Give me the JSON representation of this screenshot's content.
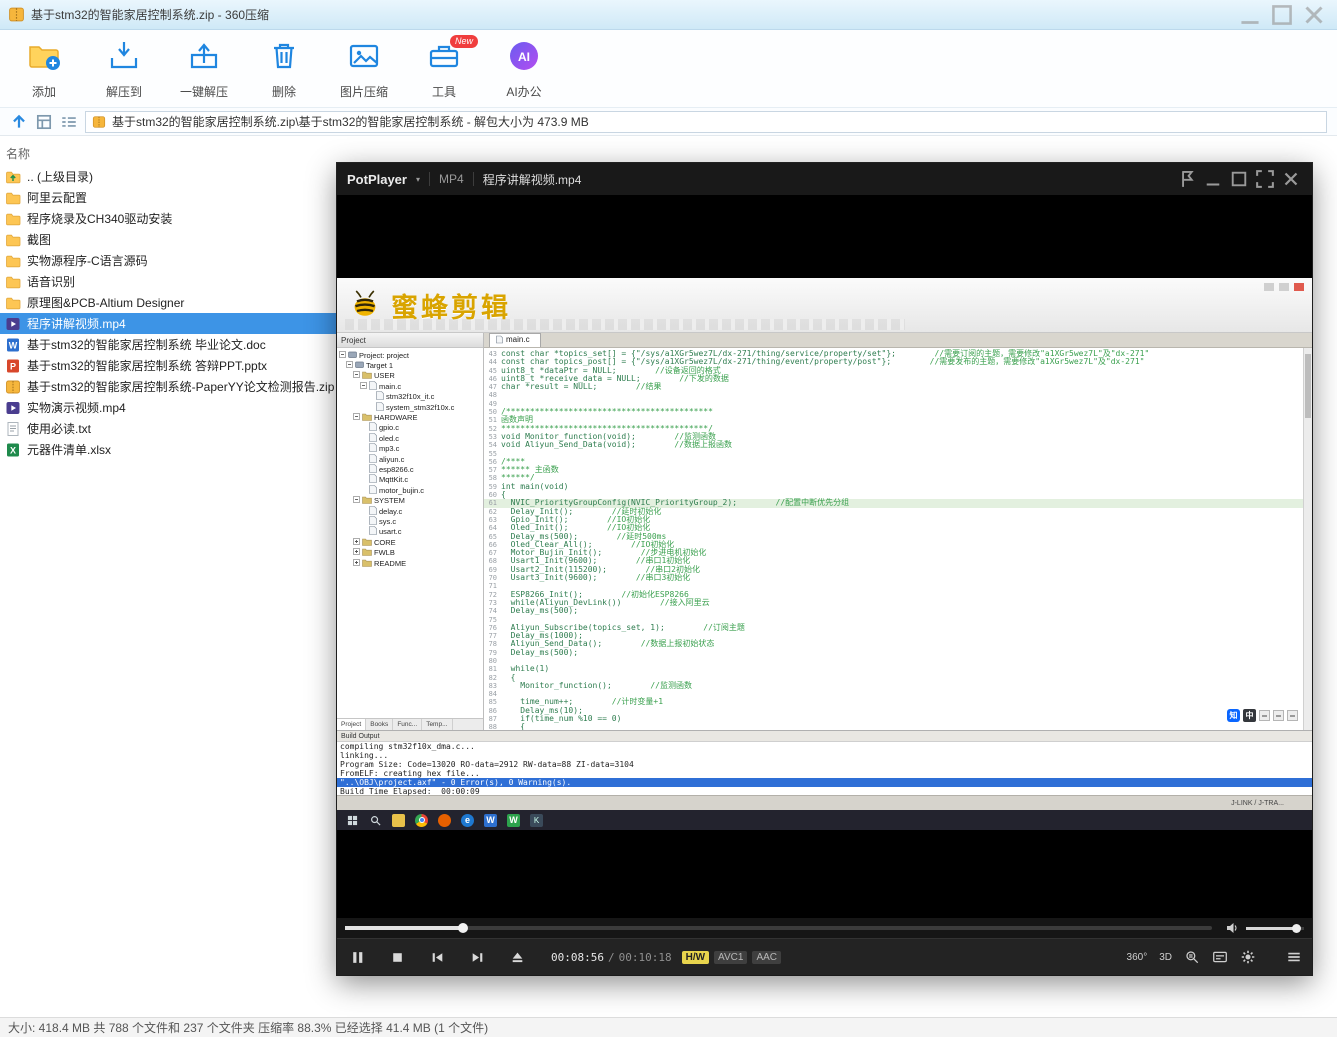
{
  "titlebar": {
    "title": "基于stm32的智能家居控制系统.zip - 360压缩"
  },
  "window_controls": [
    "minimize",
    "maximize",
    "close"
  ],
  "toolbar": {
    "items": [
      {
        "label": "添加",
        "icon": "add-files-icon"
      },
      {
        "label": "解压到",
        "icon": "extract-to-icon"
      },
      {
        "label": "一键解压",
        "icon": "one-click-extract-icon"
      },
      {
        "label": "删除",
        "icon": "delete-icon"
      },
      {
        "label": "图片压缩",
        "icon": "image-compress-icon"
      },
      {
        "label": "工具",
        "icon": "tools-icon",
        "badge": "New"
      },
      {
        "label": "AI办公",
        "icon": "ai-office-icon"
      }
    ]
  },
  "addressbar": {
    "buttons": [
      "up-icon",
      "view-grid-icon",
      "view-list-icon"
    ],
    "path": "基于stm32的智能家居控制系统.zip\\基于stm32的智能家居控制系统 - 解包大小为 473.9 MB"
  },
  "filelist": {
    "header": "名称",
    "items": [
      {
        "name": ".. (上级目录)",
        "type": "up"
      },
      {
        "name": "阿里云配置",
        "type": "folder"
      },
      {
        "name": "程序烧录及CH340驱动安装",
        "type": "folder"
      },
      {
        "name": "截图",
        "type": "folder"
      },
      {
        "name": "实物源程序-C语言源码",
        "type": "folder"
      },
      {
        "name": "语音识别",
        "type": "folder"
      },
      {
        "name": "原理图&PCB-Altium Designer",
        "type": "folder"
      },
      {
        "name": "程序讲解视频.mp4",
        "type": "mp4",
        "selected": true
      },
      {
        "name": "基于stm32的智能家居控制系统 毕业论文.doc",
        "type": "doc"
      },
      {
        "name": "基于stm32的智能家居控制系统 答辩PPT.pptx",
        "type": "ppt"
      },
      {
        "name": "基于stm32的智能家居控制系统-PaperYY论文检测报告.zip",
        "type": "zip"
      },
      {
        "name": "实物演示视频.mp4",
        "type": "mp4"
      },
      {
        "name": "使用必读.txt",
        "type": "txt"
      },
      {
        "name": "元器件清单.xlsx",
        "type": "xlsx"
      }
    ]
  },
  "statusbar": {
    "text": "大小: 418.4 MB 共 788 个文件和 237 个文件夹 压缩率 88.3% 已经选择 41.4 MB (1 个文件)"
  },
  "player": {
    "app": "PotPlayer",
    "format": "MP4",
    "file": "程序讲解视频.mp4",
    "title_buttons": [
      "pin",
      "minimize",
      "maximize",
      "fullscreen",
      "close"
    ],
    "controls": [
      "pause",
      "stop",
      "previous",
      "next",
      "open"
    ],
    "time_current": "00:08:56",
    "time_sep": "/",
    "time_total": "00:10:18",
    "decode_badge": "H/W",
    "codec_video": "AVC1",
    "codec_audio": "AAC",
    "right_labels": [
      "360°",
      "3D"
    ],
    "right_icons": [
      "subtitle-browse",
      "subtitle-panel",
      "settings"
    ],
    "menu_icon": "menu",
    "watermark": "蜜蜂剪辑"
  },
  "keil": {
    "project_header": "Project",
    "tree": [
      {
        "label": "Project: project",
        "level": 0,
        "icon": "target",
        "exp": true
      },
      {
        "label": "Target 1",
        "level": 1,
        "icon": "target",
        "exp": true
      },
      {
        "label": "USER",
        "level": 2,
        "icon": "folder",
        "exp": true
      },
      {
        "label": "main.c",
        "level": 3,
        "icon": "file",
        "exp": true
      },
      {
        "label": "stm32f10x_it.c",
        "level": 4,
        "icon": "file"
      },
      {
        "label": "system_stm32f10x.c",
        "level": 4,
        "icon": "file"
      },
      {
        "label": "HARDWARE",
        "level": 2,
        "icon": "folder",
        "exp": true
      },
      {
        "label": "gpio.c",
        "level": 3,
        "icon": "file"
      },
      {
        "label": "oled.c",
        "level": 3,
        "icon": "file"
      },
      {
        "label": "mp3.c",
        "level": 3,
        "icon": "file"
      },
      {
        "label": "aliyun.c",
        "level": 3,
        "icon": "file"
      },
      {
        "label": "esp8266.c",
        "level": 3,
        "icon": "file"
      },
      {
        "label": "MqttKit.c",
        "level": 3,
        "icon": "file"
      },
      {
        "label": "motor_bujin.c",
        "level": 3,
        "icon": "file"
      },
      {
        "label": "SYSTEM",
        "level": 2,
        "icon": "folder",
        "exp": true
      },
      {
        "label": "delay.c",
        "level": 3,
        "icon": "file"
      },
      {
        "label": "sys.c",
        "level": 3,
        "icon": "file"
      },
      {
        "label": "usart.c",
        "level": 3,
        "icon": "file"
      },
      {
        "label": "CORE",
        "level": 2,
        "icon": "folder",
        "exp": false
      },
      {
        "label": "FWLB",
        "level": 2,
        "icon": "folder",
        "exp": false
      },
      {
        "label": "README",
        "level": 2,
        "icon": "folder",
        "exp": false
      }
    ],
    "tabs": [
      {
        "label": "Project",
        "active": true
      },
      {
        "label": "Books",
        "active": false
      },
      {
        "label": "Func...",
        "active": false
      },
      {
        "label": "Temp...",
        "active": false
      }
    ],
    "editor_tab": "main.c",
    "code": [
      {
        "n": 43,
        "c": "const char *topics_set[] = {\"/sys/a1XGr5wez7L/dx-271/thing/service/property/set\"};",
        "m": "//需要订阅的主题，需要修改\"a1XGr5wez7L\"及\"dx-271\""
      },
      {
        "n": 44,
        "c": "const char topics_post[] = {\"/sys/a1XGr5wez7L/dx-271/thing/event/property/post\"};",
        "m": "//需要发布的主题，需要修改\"a1XGr5wez7L\"及\"dx-271\""
      },
      {
        "n": 45,
        "c": "uint8_t *dataPtr = NULL;",
        "m": "//设备返回的格式"
      },
      {
        "n": 46,
        "c": "uint8_t *receive_data = NULL;",
        "m": "//下发的数据"
      },
      {
        "n": 47,
        "c": "char *result = NULL;",
        "m": "//结果"
      },
      {
        "n": 48,
        "c": "",
        "m": ""
      },
      {
        "n": 49,
        "c": "",
        "m": ""
      },
      {
        "n": 50,
        "c": "",
        "m": "/*******************************************"
      },
      {
        "n": 51,
        "c": "",
        "m": "函数声明"
      },
      {
        "n": 52,
        "c": "",
        "m": "*******************************************/"
      },
      {
        "n": 53,
        "c": "void Monitor_function(void);",
        "m": "//监测函数"
      },
      {
        "n": 54,
        "c": "void Aliyun_Send_Data(void);",
        "m": "//数据上报函数"
      },
      {
        "n": 55,
        "c": "",
        "m": ""
      },
      {
        "n": 56,
        "c": "",
        "m": "/****"
      },
      {
        "n": 57,
        "c": "",
        "m": "****** 主函数"
      },
      {
        "n": 58,
        "c": "",
        "m": "******/"
      },
      {
        "n": 59,
        "c": "int main(void)",
        "m": ""
      },
      {
        "n": 60,
        "c": "{",
        "m": ""
      },
      {
        "n": 61,
        "c": "  NVIC_PriorityGroupConfig(NVIC_PriorityGroup_2);",
        "m": "//配置中断优先分组",
        "hl": true
      },
      {
        "n": 62,
        "c": "  Delay_Init();",
        "m": "//延时初始化"
      },
      {
        "n": 63,
        "c": "  Gpio_Init();",
        "m": "//IO初始化"
      },
      {
        "n": 64,
        "c": "  Oled_Init();",
        "m": "//IO初始化"
      },
      {
        "n": 65,
        "c": "  Delay_ms(500);",
        "m": "//延时500ms"
      },
      {
        "n": 66,
        "c": "  Oled_Clear_All();",
        "m": "//IO初始化"
      },
      {
        "n": 67,
        "c": "  Motor_Bujin_Init();",
        "m": "//步进电机初始化"
      },
      {
        "n": 68,
        "c": "  Usart1_Init(9600);",
        "m": "//串口1初始化"
      },
      {
        "n": 69,
        "c": "  Usart2_Init(115200);",
        "m": "//串口2初始化"
      },
      {
        "n": 70,
        "c": "  Usart3_Init(9600);",
        "m": "//串口3初始化"
      },
      {
        "n": 71,
        "c": "",
        "m": ""
      },
      {
        "n": 72,
        "c": "  ESP8266_Init();",
        "m": "//初始化ESP8266"
      },
      {
        "n": 73,
        "c": "  while(Aliyun_DevLink())",
        "m": "//接入阿里云"
      },
      {
        "n": 74,
        "c": "  Delay_ms(500);",
        "m": ""
      },
      {
        "n": 75,
        "c": "",
        "m": ""
      },
      {
        "n": 76,
        "c": "  Aliyun_Subscribe(topics_set, 1);",
        "m": "//订阅主题"
      },
      {
        "n": 77,
        "c": "  Delay_ms(1000);",
        "m": ""
      },
      {
        "n": 78,
        "c": "  Aliyun_Send_Data();",
        "m": "//数据上报初始状态"
      },
      {
        "n": 79,
        "c": "  Delay_ms(500);",
        "m": ""
      },
      {
        "n": 80,
        "c": "",
        "m": ""
      },
      {
        "n": 81,
        "c": "  while(1)",
        "m": ""
      },
      {
        "n": 82,
        "c": "  {",
        "m": ""
      },
      {
        "n": 83,
        "c": "    Monitor_function();",
        "m": "//监测函数"
      },
      {
        "n": 84,
        "c": "",
        "m": ""
      },
      {
        "n": 85,
        "c": "    time_num++;",
        "m": "//计时变量+1"
      },
      {
        "n": 86,
        "c": "    Delay_ms(10);",
        "m": ""
      },
      {
        "n": 87,
        "c": "    if(time_num %10 == 0)",
        "m": ""
      },
      {
        "n": 88,
        "c": "    {",
        "m": ""
      }
    ],
    "build_header": "Build Output",
    "build": [
      "compiling stm32f10x_dma.c...",
      "linking...",
      "Program Size: Code=13020 RO-data=2912 RW-data=88 ZI-data=3104",
      "FromELF: creating hex file...",
      "\"..\\OBJ\\project.axf\" - 0 Error(s), 0 Warning(s).",
      "Build Time Elapsed:  00:00:09"
    ],
    "build_highlight_index": 4,
    "status_right": "J-LINK / J-TRA...",
    "taskbar_icons": [
      "start",
      "search",
      "explorer",
      "chrome",
      "firefox",
      "edge",
      "word",
      "wps",
      "keil"
    ],
    "tray": [
      {
        "icon": "zhihu-icon",
        "glyph": "知"
      },
      {
        "icon": "input-method-cn-icon",
        "glyph": "中"
      },
      {
        "icon": "tray-tool-icon",
        "glyph": ""
      },
      {
        "icon": "tray-tool-icon",
        "glyph": ""
      },
      {
        "icon": "tray-tool-icon",
        "glyph": ""
      }
    ]
  }
}
